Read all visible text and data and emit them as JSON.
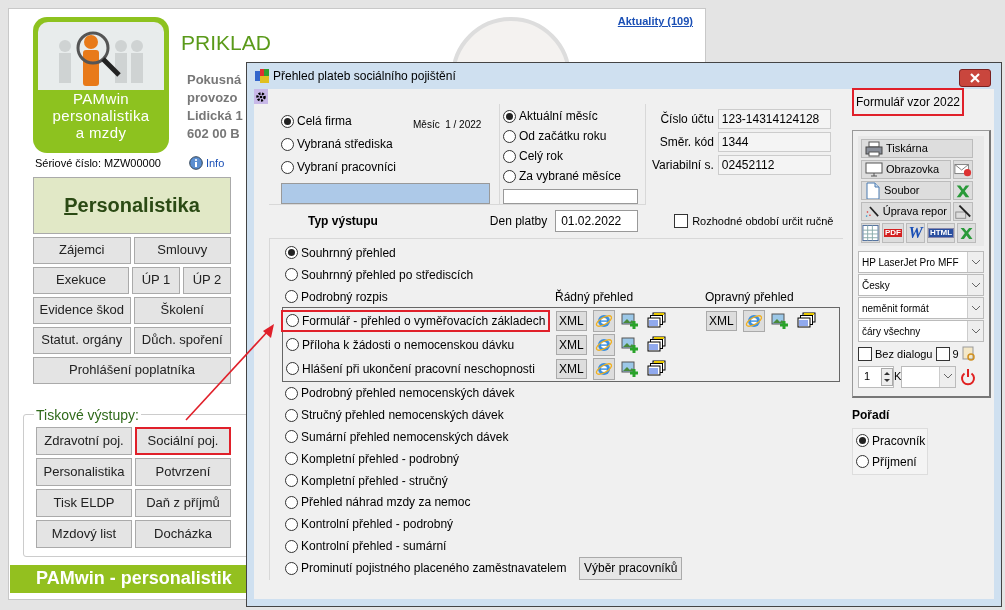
{
  "app": {
    "logo_lines": [
      "PAMwin",
      "personalistika",
      "a mzdy"
    ],
    "company_title": "PRIKLAD",
    "address_lines": [
      "Pokusná",
      "provozo",
      "Lidická 1",
      "602 00 B"
    ],
    "news_link": "Aktuality (109)",
    "serial": "Sériové číslo: MZW00000",
    "info_link": "Info",
    "main_button": "Personalistika",
    "module_rows": [
      [
        "Zájemci",
        "Smlouvy"
      ],
      [
        "Exekuce",
        "ÚP 1",
        "ÚP 2"
      ],
      [
        "Evidence škod",
        "Školení"
      ],
      [
        "Statut. orgány",
        "Důch. spoření"
      ],
      [
        "Prohlášení poplatníka"
      ]
    ],
    "print_section": {
      "title": "Tiskové výstupy:",
      "buttons": [
        {
          "label": "Zdravotní poj.",
          "highlighted": false
        },
        {
          "label": "Sociální poj.",
          "highlighted": true
        },
        {
          "label": "Personalistika",
          "highlighted": false
        },
        {
          "label": "Potvrzení",
          "highlighted": false
        },
        {
          "label": "Tisk ELDP",
          "highlighted": false
        },
        {
          "label": "Daň z příjmů",
          "highlighted": false
        },
        {
          "label": "Mzdový list",
          "highlighted": false
        },
        {
          "label": "Docházka",
          "highlighted": false
        }
      ]
    },
    "footer": "PAMwin - personalistik"
  },
  "dialog": {
    "title": "Přehled plateb sociálního pojištění",
    "scope_options": [
      {
        "label": "Celá firma",
        "selected": true
      },
      {
        "label": "Vybraná střediska",
        "selected": false
      },
      {
        "label": "Vybraní pracovníci",
        "selected": false
      }
    ],
    "month_label": "Měsíc  1 / 2022",
    "period_options": [
      {
        "label": "Aktuální měsíc",
        "selected": true
      },
      {
        "label": "Od začátku roku",
        "selected": false
      },
      {
        "label": "Celý rok",
        "selected": false
      },
      {
        "label": "Za vybrané měsíce",
        "selected": false
      }
    ],
    "account_fields": [
      {
        "label": "Číslo účtu",
        "value": "123-14314124128"
      },
      {
        "label": "Směr. kód",
        "value": "1344"
      },
      {
        "label": "Variabilní s.",
        "value": "02452112"
      }
    ],
    "output_type_heading": "Typ výstupu",
    "payment_day": {
      "label": "Den platby",
      "value": "01.02.2022"
    },
    "manual_period": {
      "label": "Rozhodné období určit ručně",
      "checked": false
    },
    "column_headings": [
      "Řádný přehled",
      "Opravný přehled"
    ],
    "outputs": [
      {
        "kind": "plain",
        "label": "Souhrnný přehled",
        "selected": true,
        "highlighted": false
      },
      {
        "kind": "plain",
        "label": "Souhrnný přehled po střediscích",
        "selected": false,
        "highlighted": false
      },
      {
        "kind": "plain",
        "label": "Podrobný rozpis",
        "selected": false,
        "highlighted": false
      },
      {
        "kind": "export",
        "label": "Formulář - přehled o vyměřovacích základech",
        "selected": false,
        "highlighted": true,
        "regular_xml": "XML",
        "corrective_xml": "XML"
      },
      {
        "kind": "export",
        "label": "Příloha k žádosti o nemocenskou dávku",
        "selected": false,
        "highlighted": false,
        "regular_xml": "XML"
      },
      {
        "kind": "export",
        "label": "Hlášení při ukončení pracovní neschopnosti",
        "selected": false,
        "highlighted": false,
        "regular_xml": "XML"
      },
      {
        "kind": "plain",
        "label": "Podrobný přehled nemocenských dávek",
        "selected": false,
        "highlighted": false
      },
      {
        "kind": "plain",
        "label": "Stručný přehled nemocenských dávek",
        "selected": false,
        "highlighted": false
      },
      {
        "kind": "plain",
        "label": "Sumární přehled nemocenských dávek",
        "selected": false,
        "highlighted": false
      },
      {
        "kind": "plain",
        "label": "Kompletní přehled - podrobný",
        "selected": false,
        "highlighted": false
      },
      {
        "kind": "plain",
        "label": "Kompletní přehled - stručný",
        "selected": false,
        "highlighted": false
      },
      {
        "kind": "plain",
        "label": "Přehled  náhrad  mzdy za nemoc",
        "selected": false,
        "highlighted": false
      },
      {
        "kind": "plain",
        "label": "Kontrolní přehled - podrobný",
        "selected": false,
        "highlighted": false
      },
      {
        "kind": "plain",
        "label": "Kontrolní přehled - sumární",
        "selected": false,
        "highlighted": false
      },
      {
        "kind": "with_button",
        "label": "Prominutí pojistného placeného zaměstnavatelem",
        "selected": false,
        "highlighted": false,
        "button": "Výběr pracovníků"
      }
    ],
    "template_label": {
      "text": "Formulář vzor 2022",
      "highlighted": true
    },
    "output_buttons": [
      {
        "kind": "printer",
        "label": "Tiskárna"
      },
      {
        "kind": "screen",
        "label": "Obrazovka",
        "side": {
          "kind": "email"
        }
      },
      {
        "kind": "file",
        "label": "Soubor",
        "side": {
          "kind": "excel"
        }
      },
      {
        "kind": "edit",
        "label": "Úprava repor",
        "side": {
          "kind": "wand"
        }
      }
    ],
    "format_icons": [
      {
        "kind": "table"
      },
      {
        "kind": "pdf",
        "text": "PDF"
      },
      {
        "kind": "word",
        "text": "W"
      },
      {
        "kind": "html",
        "text": "HTML"
      },
      {
        "kind": "excel"
      }
    ],
    "selects": [
      "HP LaserJet Pro MFF",
      "Česky",
      "neměnit formát",
      "čáry všechny"
    ],
    "no_dialog": {
      "label": "Bez dialogu",
      "checked": false
    },
    "option_9": {
      "label": "9",
      "checked": false
    },
    "copies": "1",
    "k_label": "K",
    "order": {
      "heading": "Pořadí",
      "options": [
        {
          "label": "Pracovník",
          "selected": true
        },
        {
          "label": "Příjmení",
          "selected": false
        }
      ]
    }
  }
}
